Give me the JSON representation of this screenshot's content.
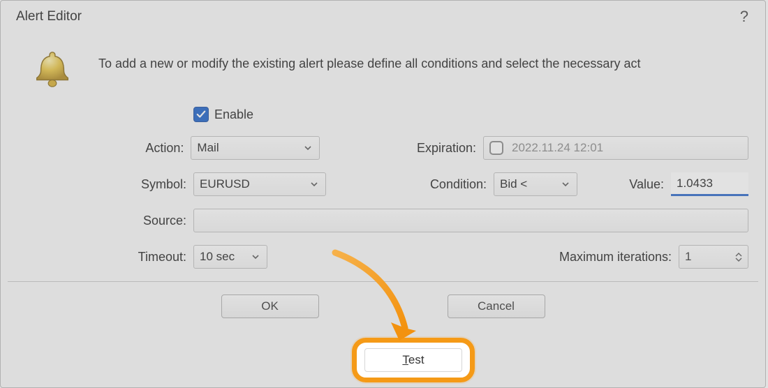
{
  "title": "Alert Editor",
  "intro": "To add a new or modify the existing alert please define all conditions and select the necessary act",
  "enable_label": "Enable",
  "enable_checked": true,
  "labels": {
    "action": "Action:",
    "symbol": "Symbol:",
    "source": "Source:",
    "timeout": "Timeout:",
    "expiration": "Expiration:",
    "condition": "Condition:",
    "value": "Value:",
    "max_iter": "Maximum iterations:"
  },
  "fields": {
    "action": "Mail",
    "symbol": "EURUSD",
    "timeout": "10 sec",
    "expiration_checked": false,
    "expiration_text": "2022.11.24 12:01",
    "condition": "Bid <",
    "value": "1.0433",
    "max_iter": "1",
    "source": ""
  },
  "buttons": {
    "ok": "OK",
    "test": "Test",
    "cancel": "Cancel"
  },
  "help": "?"
}
